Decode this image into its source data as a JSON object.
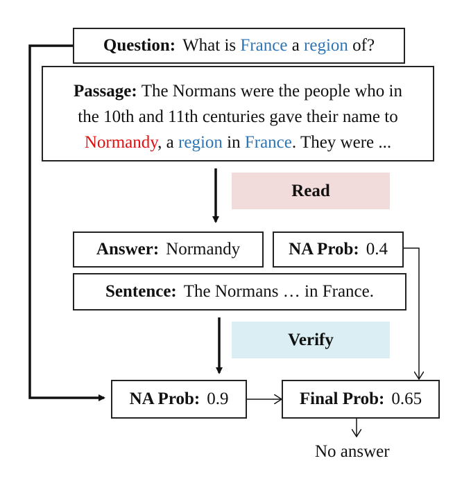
{
  "question": {
    "label": "Question:",
    "t1": "What is",
    "w1": "France",
    "t2": "a",
    "w2": "region",
    "t3": "of?"
  },
  "passage": {
    "label": "Passage:",
    "l1": "The Normans were the people who in",
    "l2": "the 10th and 11th centuries gave their name to",
    "w_normandy": "Normandy",
    "t_a": ", a",
    "w_region": "region",
    "t_in": "in",
    "w_france": "France",
    "t_end": ". They were ..."
  },
  "read_label": "Read",
  "answer": {
    "label": "Answer:",
    "value": "Normandy"
  },
  "na_read": {
    "label": "NA Prob:",
    "value": "0.4"
  },
  "sentence": {
    "label": "Sentence:",
    "value": "The Normans … in France."
  },
  "verify_label": "Verify",
  "na_verify": {
    "label": "NA Prob:",
    "value": "0.9"
  },
  "final": {
    "label": "Final Prob:",
    "value": "0.65"
  },
  "result": "No answer",
  "colors": {
    "highlight_blue": "#2e75b6",
    "highlight_red": "#e01010",
    "read_fill": "#f2dcdb",
    "verify_fill": "#daeef3"
  }
}
